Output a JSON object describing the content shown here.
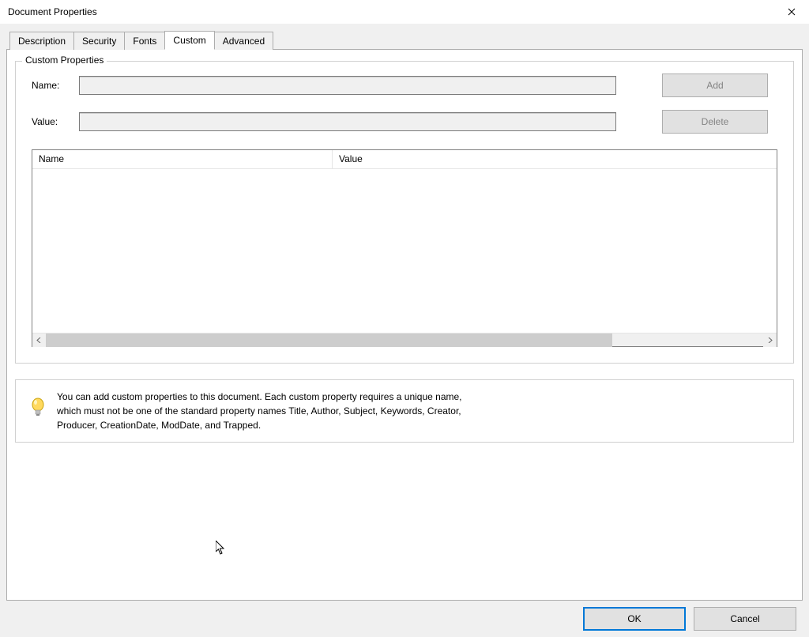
{
  "title": "Document Properties",
  "tabs": [
    {
      "label": "Description",
      "active": false
    },
    {
      "label": "Security",
      "active": false
    },
    {
      "label": "Fonts",
      "active": false
    },
    {
      "label": "Custom",
      "active": true
    },
    {
      "label": "Advanced",
      "active": false
    }
  ],
  "group": {
    "legend": "Custom Properties",
    "name_label": "Name:",
    "value_label": "Value:",
    "name_value": "",
    "value_value": "",
    "add_label": "Add",
    "delete_label": "Delete",
    "columns": {
      "name": "Name",
      "value": "Value"
    },
    "rows": []
  },
  "info": {
    "text": "You can add custom properties to this document. Each custom property requires a unique name, which must not be one of the standard property names Title, Author, Subject, Keywords, Creator, Producer, CreationDate, ModDate, and Trapped."
  },
  "buttons": {
    "ok": "OK",
    "cancel": "Cancel"
  }
}
